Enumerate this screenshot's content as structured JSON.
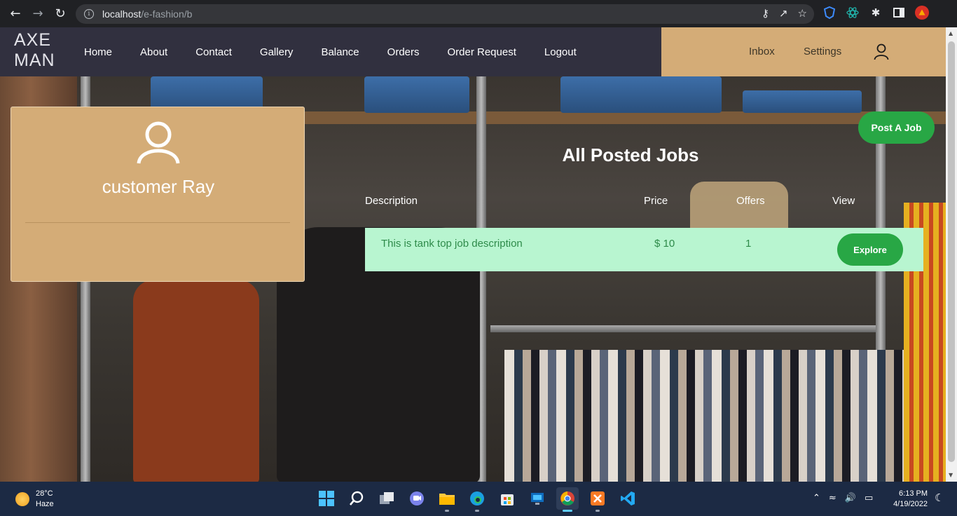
{
  "browser": {
    "url_host": "localhost",
    "url_path": "/e-fashion/b"
  },
  "site": {
    "logo_line1": "AXE",
    "logo_line2": "MAN",
    "nav": [
      "Home",
      "About",
      "Contact",
      "Gallery",
      "Balance",
      "Orders",
      "Order Request",
      "Logout"
    ],
    "user_links": {
      "inbox": "Inbox",
      "settings": "Settings"
    }
  },
  "profile": {
    "name": "customer Ray"
  },
  "jobs": {
    "post_button": "Post A Job",
    "title": "All Posted Jobs",
    "headers": {
      "description": "Description",
      "price": "Price",
      "offers": "Offers",
      "view": "View"
    },
    "rows": [
      {
        "description": "This is tank top job description",
        "price": "$ 10",
        "offers": "1",
        "action": "Explore"
      }
    ]
  },
  "taskbar": {
    "temperature": "28°C",
    "condition": "Haze",
    "time": "6:13 PM",
    "date": "4/19/2022"
  },
  "colors": {
    "accent": "#d4ac77",
    "header": "#31303f",
    "success": "#28a745",
    "row": "#b8f5d0"
  }
}
